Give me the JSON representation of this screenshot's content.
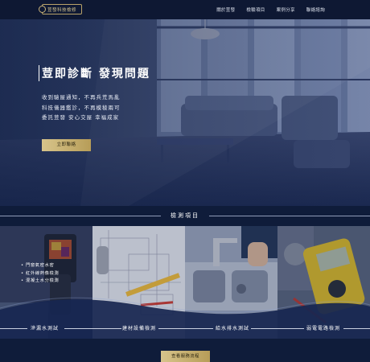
{
  "nav": {
    "logo_text": "荳發科技檢修",
    "menu": [
      "關於荳發",
      "檢驗項目",
      "案例分享",
      "聯絡諮詢"
    ]
  },
  "hero": {
    "title": "荳即診斷 發現問題",
    "lines": [
      "收到驗屋通知，不再兵荒馬亂",
      "科技儀器鑑診，不再模稜兩可",
      "委託荳發 安心交屋 幸福成家"
    ],
    "button_label": "立即聯絡"
  },
  "section": {
    "title": "檢測項目"
  },
  "cards": [
    {
      "label": "滲漏水測試",
      "bullets": [
        "門窗氣密水密",
        "紅外線熱像檢測",
        "混凝土水分檢測"
      ]
    },
    {
      "label": "建材設備檢測"
    },
    {
      "label": "給水排水測試"
    },
    {
      "label": "弱電電路檢測"
    }
  ],
  "more_button": "查看服務流程",
  "colors": {
    "navy": "#0f1c3a",
    "gold": "#c9b37a"
  }
}
